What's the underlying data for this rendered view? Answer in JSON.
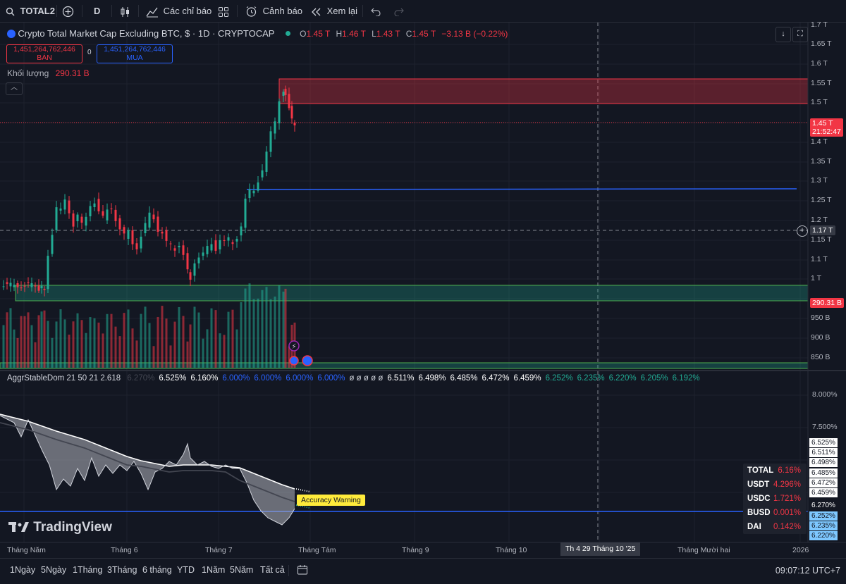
{
  "toolbar": {
    "symbol": "TOTAL2",
    "interval": "D",
    "indicators_label": "Các chỉ báo",
    "alerts_label": "Cảnh báo",
    "replay_label": "Xem lại"
  },
  "legend": {
    "title": "Crypto Total Market Cap Excluding BTC, $ · 1D · CRYPTOCAP",
    "o_label": "O",
    "o_value": "1.45 T",
    "h_label": "H",
    "h_value": "1.46 T",
    "l_label": "L",
    "l_value": "1.43 T",
    "c_label": "C",
    "c_value": "1.45 T",
    "change": "−3.13 B (−0.22%)",
    "sell_price": "1,451,264,762,446",
    "sell_label": "BÁN",
    "spread": "0",
    "buy_price": "1,451,264,762,446",
    "buy_label": "MUA",
    "volume_label": "Khối lượng",
    "volume_value": "290.31 B"
  },
  "price_axis": {
    "labels": [
      "1.7 T",
      "1.65 T",
      "1.6 T",
      "1.55 T",
      "1.5 T",
      "1.4 T",
      "1.35 T",
      "1.3 T",
      "1.25 T",
      "1.2 T",
      "1.15 T",
      "1.1 T",
      "1 T",
      "950 B",
      "900 B",
      "850 B"
    ],
    "current_price": "1.45 T",
    "countdown": "21:52:47",
    "crosshair_price": "1.17 T",
    "volume_badge": "290.31 B"
  },
  "indicator": {
    "name": "AggrStableDom 21 50 21 2.618",
    "values": [
      {
        "t": "6.270%",
        "c": "#434651"
      },
      {
        "t": "6.525%",
        "c": "#ffffff"
      },
      {
        "t": "6.160%",
        "c": "#ffffff"
      },
      {
        "t": "6.000%",
        "c": "#2962ff"
      },
      {
        "t": "6.000%",
        "c": "#2962ff"
      },
      {
        "t": "6.000%",
        "c": "#2962ff"
      },
      {
        "t": "6.000%",
        "c": "#2962ff"
      },
      {
        "t": "ø ø ø ø ø",
        "c": "#d1d4dc"
      },
      {
        "t": "6.511%",
        "c": "#ffffff"
      },
      {
        "t": "6.498%",
        "c": "#ffffff"
      },
      {
        "t": "6.485%",
        "c": "#ffffff"
      },
      {
        "t": "6.472%",
        "c": "#ffffff"
      },
      {
        "t": "6.459%",
        "c": "#ffffff"
      },
      {
        "t": "6.252%",
        "c": "#22ab94"
      },
      {
        "t": "6.235%",
        "c": "#22ab94"
      },
      {
        "t": "6.220%",
        "c": "#22ab94"
      },
      {
        "t": "6.205%",
        "c": "#22ab94"
      },
      {
        "t": "6.192%",
        "c": "#22ab94"
      }
    ],
    "axis_labels": [
      "8.000%",
      "7.500%"
    ],
    "right_labels": [
      {
        "t": "6.525%",
        "bg": "#ffffff"
      },
      {
        "t": "6.511%",
        "bg": "#ffffff"
      },
      {
        "t": "6.498%",
        "bg": "#ffffff"
      },
      {
        "t": "6.485%",
        "bg": "#ffffff"
      },
      {
        "t": "6.472%",
        "bg": "#ffffff"
      },
      {
        "t": "6.459%",
        "bg": "#ffffff"
      },
      {
        "t": "6.270%",
        "bg": "#131722",
        "fg": "#ffffff"
      },
      {
        "t": "6.252%",
        "bg": "#7ec8ff"
      },
      {
        "t": "6.235%",
        "bg": "#7ec8ff"
      },
      {
        "t": "6.220%",
        "bg": "#7ec8ff"
      }
    ],
    "table": [
      {
        "name": "TOTAL",
        "value": "6.16%"
      },
      {
        "name": "USDT",
        "value": "4.296%"
      },
      {
        "name": "USDC",
        "value": "1.721%"
      },
      {
        "name": "BUSD",
        "value": "0.001%"
      },
      {
        "name": "DAI",
        "value": "0.142%"
      }
    ],
    "warning": "Accuracy Warning"
  },
  "time_axis": {
    "labels": [
      "Tháng Năm",
      "Tháng 6",
      "Tháng 7",
      "Tháng Tám",
      "Tháng 9",
      "Tháng 10",
      "Tháng Mười hai",
      "2026"
    ],
    "crosshair_date": "Th 4 29 Tháng 10 '25"
  },
  "watermark": "TradingView",
  "bottom_bar": {
    "ranges": [
      "1Ngày",
      "5Ngày",
      "1Tháng",
      "3Tháng",
      "6 tháng",
      "YTD",
      "1Năm",
      "5Năm",
      "Tất cả"
    ],
    "clock": "09:07:12 UTC+7"
  },
  "colors": {
    "up": "#22ab94",
    "down": "#f23645",
    "background": "#131722",
    "accent_blue": "#2962ff"
  }
}
